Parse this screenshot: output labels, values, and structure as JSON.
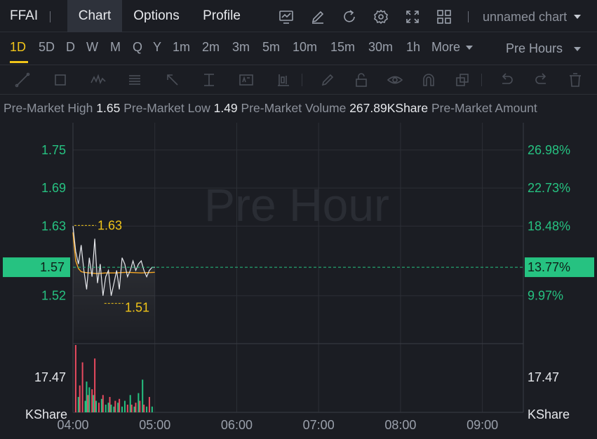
{
  "header": {
    "symbol": "FFAI",
    "tabs": [
      {
        "label": "Chart",
        "active": true
      },
      {
        "label": "Options",
        "active": false
      },
      {
        "label": "Profile",
        "active": false
      }
    ],
    "icons": [
      "indicator-icon",
      "draw-icon",
      "refresh-icon",
      "settings-icon",
      "fullscreen-icon",
      "layout-icon"
    ],
    "chart_name": "unnamed chart"
  },
  "intervals": {
    "items": [
      "1D",
      "5D",
      "D",
      "W",
      "M",
      "Q",
      "Y",
      "1m",
      "2m",
      "3m",
      "5m",
      "10m",
      "15m",
      "30m",
      "1h",
      "More"
    ],
    "active": "1D",
    "session": "Pre Hours"
  },
  "draw_tools": [
    "trend-line-icon",
    "rectangle-icon",
    "pattern-icon",
    "fib-icon",
    "arrow-icon",
    "price-range-icon",
    "text-icon",
    "long-short-icon",
    "pencil-icon",
    "lock-icon",
    "eye-icon",
    "magnet-icon",
    "clone-icon",
    "undo-icon",
    "trash-icon"
  ],
  "info": {
    "high_label": "Pre-Market High",
    "high": "1.65",
    "low_label": "Pre-Market Low",
    "low": "1.49",
    "volume_label": "Pre-Market Volume",
    "volume": "267.89KShare",
    "amount_label": "Pre-Market Amount"
  },
  "colors": {
    "up": "#26c281",
    "down": "#e84a5f",
    "price_line": "#e6e8ec",
    "avg_line": "#f5a623",
    "annotation": "#f0c419",
    "grid": "#2c2f36",
    "watermark": "#2a2d34"
  },
  "chart_data": {
    "type": "line",
    "watermark": "Pre Hour",
    "x_ticks": [
      "04:00",
      "05:00",
      "06:00",
      "07:00",
      "08:00",
      "09:00"
    ],
    "x_range_minutes": [
      0,
      330
    ],
    "y_range": [
      1.45,
      1.793
    ],
    "y_ticks_left": [
      "1.75",
      "1.69",
      "1.63",
      "1.57",
      "1.52"
    ],
    "y_ticks_left_values": [
      1.75,
      1.69,
      1.63,
      1.57,
      1.52
    ],
    "y_ticks_right": [
      "26.98%",
      "22.73%",
      "18.48%",
      "13.77%",
      "9.97%"
    ],
    "current_price": "1.57",
    "current_pct": "13.77%",
    "current_value": 1.565,
    "high_annotation": {
      "label": "1.63",
      "minute": 1,
      "value": 1.631
    },
    "low_annotation": {
      "label": "1.51",
      "minute": 23,
      "value": 1.508
    },
    "price_series": {
      "minutes": [
        0,
        2,
        4,
        6,
        8,
        10,
        12,
        14,
        16,
        18,
        20,
        22,
        24,
        26,
        28,
        30,
        32,
        34,
        36,
        38,
        40,
        42,
        44,
        46,
        48,
        50,
        52,
        54,
        56,
        58,
        60
      ],
      "values": [
        1.63,
        1.59,
        1.57,
        1.6,
        1.56,
        1.53,
        1.58,
        1.55,
        1.61,
        1.54,
        1.57,
        1.52,
        1.55,
        1.56,
        1.52,
        1.54,
        1.56,
        1.53,
        1.58,
        1.57,
        1.55,
        1.56,
        1.575,
        1.56,
        1.57,
        1.575,
        1.56,
        1.55,
        1.56,
        1.565,
        1.565
      ]
    },
    "avg_series": {
      "minutes": [
        0,
        2,
        4,
        6,
        8,
        12,
        18,
        24,
        30,
        40,
        50,
        60
      ],
      "values": [
        1.62,
        1.575,
        1.563,
        1.558,
        1.557,
        1.556,
        1.555,
        1.556,
        1.556,
        1.557,
        1.556,
        1.557
      ]
    },
    "volume": {
      "label_left": "17.47",
      "label_right": "17.47",
      "unit_left": "KShare",
      "unit_right": "KShare",
      "max": 35,
      "bars": [
        {
          "m": 2,
          "v": 35,
          "d": "down"
        },
        {
          "m": 4,
          "v": 8,
          "d": "up"
        },
        {
          "m": 5,
          "v": 14,
          "d": "down"
        },
        {
          "m": 7,
          "v": 26,
          "d": "down"
        },
        {
          "m": 9,
          "v": 6,
          "d": "up"
        },
        {
          "m": 10,
          "v": 16,
          "d": "up"
        },
        {
          "m": 11,
          "v": 9,
          "d": "down"
        },
        {
          "m": 12,
          "v": 13,
          "d": "up"
        },
        {
          "m": 14,
          "v": 12,
          "d": "down"
        },
        {
          "m": 15,
          "v": 9,
          "d": "up"
        },
        {
          "m": 16,
          "v": 28,
          "d": "down"
        },
        {
          "m": 17,
          "v": 6,
          "d": "up"
        },
        {
          "m": 19,
          "v": 5,
          "d": "down"
        },
        {
          "m": 21,
          "v": 7,
          "d": "up"
        },
        {
          "m": 22,
          "v": 9,
          "d": "down"
        },
        {
          "m": 24,
          "v": 4,
          "d": "up"
        },
        {
          "m": 26,
          "v": 5,
          "d": "up"
        },
        {
          "m": 27,
          "v": 8,
          "d": "down"
        },
        {
          "m": 28,
          "v": 4,
          "d": "up"
        },
        {
          "m": 30,
          "v": 3,
          "d": "up"
        },
        {
          "m": 31,
          "v": 6,
          "d": "down"
        },
        {
          "m": 33,
          "v": 5,
          "d": "up"
        },
        {
          "m": 34,
          "v": 7,
          "d": "down"
        },
        {
          "m": 36,
          "v": 3,
          "d": "up"
        },
        {
          "m": 38,
          "v": 6,
          "d": "up"
        },
        {
          "m": 40,
          "v": 4,
          "d": "down"
        },
        {
          "m": 42,
          "v": 9,
          "d": "up"
        },
        {
          "m": 43,
          "v": 4,
          "d": "down"
        },
        {
          "m": 45,
          "v": 3,
          "d": "up"
        },
        {
          "m": 46,
          "v": 5,
          "d": "down"
        },
        {
          "m": 48,
          "v": 10,
          "d": "up"
        },
        {
          "m": 49,
          "v": 6,
          "d": "down"
        },
        {
          "m": 51,
          "v": 17,
          "d": "up"
        },
        {
          "m": 52,
          "v": 4,
          "d": "down"
        },
        {
          "m": 54,
          "v": 3,
          "d": "up"
        },
        {
          "m": 56,
          "v": 8,
          "d": "down"
        },
        {
          "m": 58,
          "v": 3,
          "d": "up"
        }
      ]
    }
  }
}
